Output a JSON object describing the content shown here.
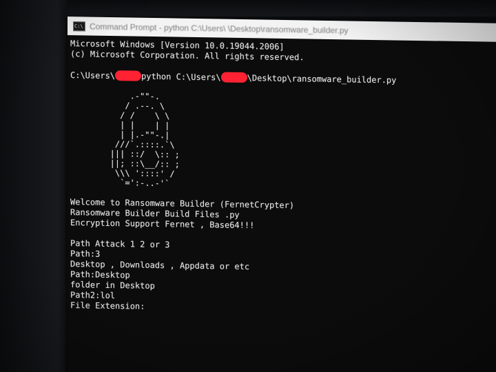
{
  "window": {
    "title": "Command Prompt - python C:\\Users\\      \\Desktop\\ransomware_builder.py",
    "icon": "cmd-icon"
  },
  "console": {
    "header1": "Microsoft Windows [Version 10.0.19044.2006]",
    "header2": "(c) Microsoft Corporation. All rights reserved.",
    "prompt_prefix": "C:\\Users\\",
    "prompt_cmd": "python C:\\Users\\",
    "prompt_path_tail": "\\Desktop\\ransomware_builder.py",
    "ascii_art": [
      "       .-\"\"-.",
      "      / .--. \\",
      "     / /    \\ \\",
      "     | |    | |",
      "     | |.-\"\"-.|",
      "    ///`.::::.`\\",
      "   ||| ::/  \\:: ;",
      "   ||; ::\\__/:: ;",
      "    \\\\\\ '::::' /",
      "     `=':-..-'`"
    ],
    "welcome1": "Welcome to Ransomware Builder (FernetCrypter)",
    "welcome2": "Ransomware Builder Build Files .py",
    "welcome3": "Encryption Support Fernet , Base64!!!",
    "q1": "Path Attack 1 2 or 3",
    "a1": "Path:3",
    "q2": "Desktop , Downloads , Appdata or etc",
    "a2": "Path:Desktop",
    "q3": "folder in Desktop",
    "a3": "Path2:lol",
    "q4": "File Extension:"
  },
  "colors": {
    "console_bg": "#0c0c0c",
    "console_text": "#e6e6e6",
    "titlebar_bg": "#f3f3f3",
    "redaction": "#ff2233"
  }
}
